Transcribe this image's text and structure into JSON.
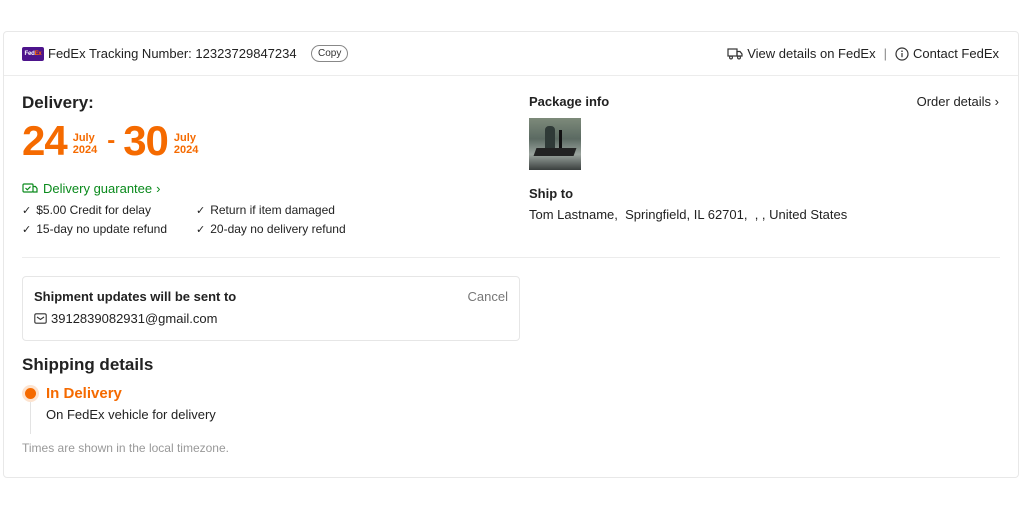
{
  "header": {
    "logo_text": "FedEx",
    "tracking_label": "FedEx Tracking Number: 12323729847234",
    "copy_label": "Copy",
    "view_details_label": "View details on FedEx",
    "separator": "|",
    "contact_label": "Contact FedEx"
  },
  "delivery": {
    "label": "Delivery:",
    "start": {
      "day": "24",
      "month": "July",
      "year": "2024"
    },
    "dash": "-",
    "end": {
      "day": "30",
      "month": "July",
      "year": "2024"
    },
    "accent_color": "#f56a00"
  },
  "guarantee": {
    "label": "Delivery guarantee",
    "color": "#0a8a1c",
    "perks": [
      "$5.00 Credit for delay",
      "Return if item damaged",
      "15-day no update refund",
      "20-day no delivery refund"
    ]
  },
  "package": {
    "label": "Package info",
    "order_details_label": "Order details",
    "ship_to_label": "Ship to",
    "ship_to_address": "Tom Lastname,  Springfield, IL 62701,  , , United States"
  },
  "updates": {
    "title": "Shipment updates will be sent to",
    "cancel_label": "Cancel",
    "email": "3912839082931@gmail.com"
  },
  "shipping": {
    "title": "Shipping details",
    "status": "In Delivery",
    "status_desc": "On FedEx vehicle for delivery",
    "timezone_note": "Times are shown in the local timezone."
  }
}
